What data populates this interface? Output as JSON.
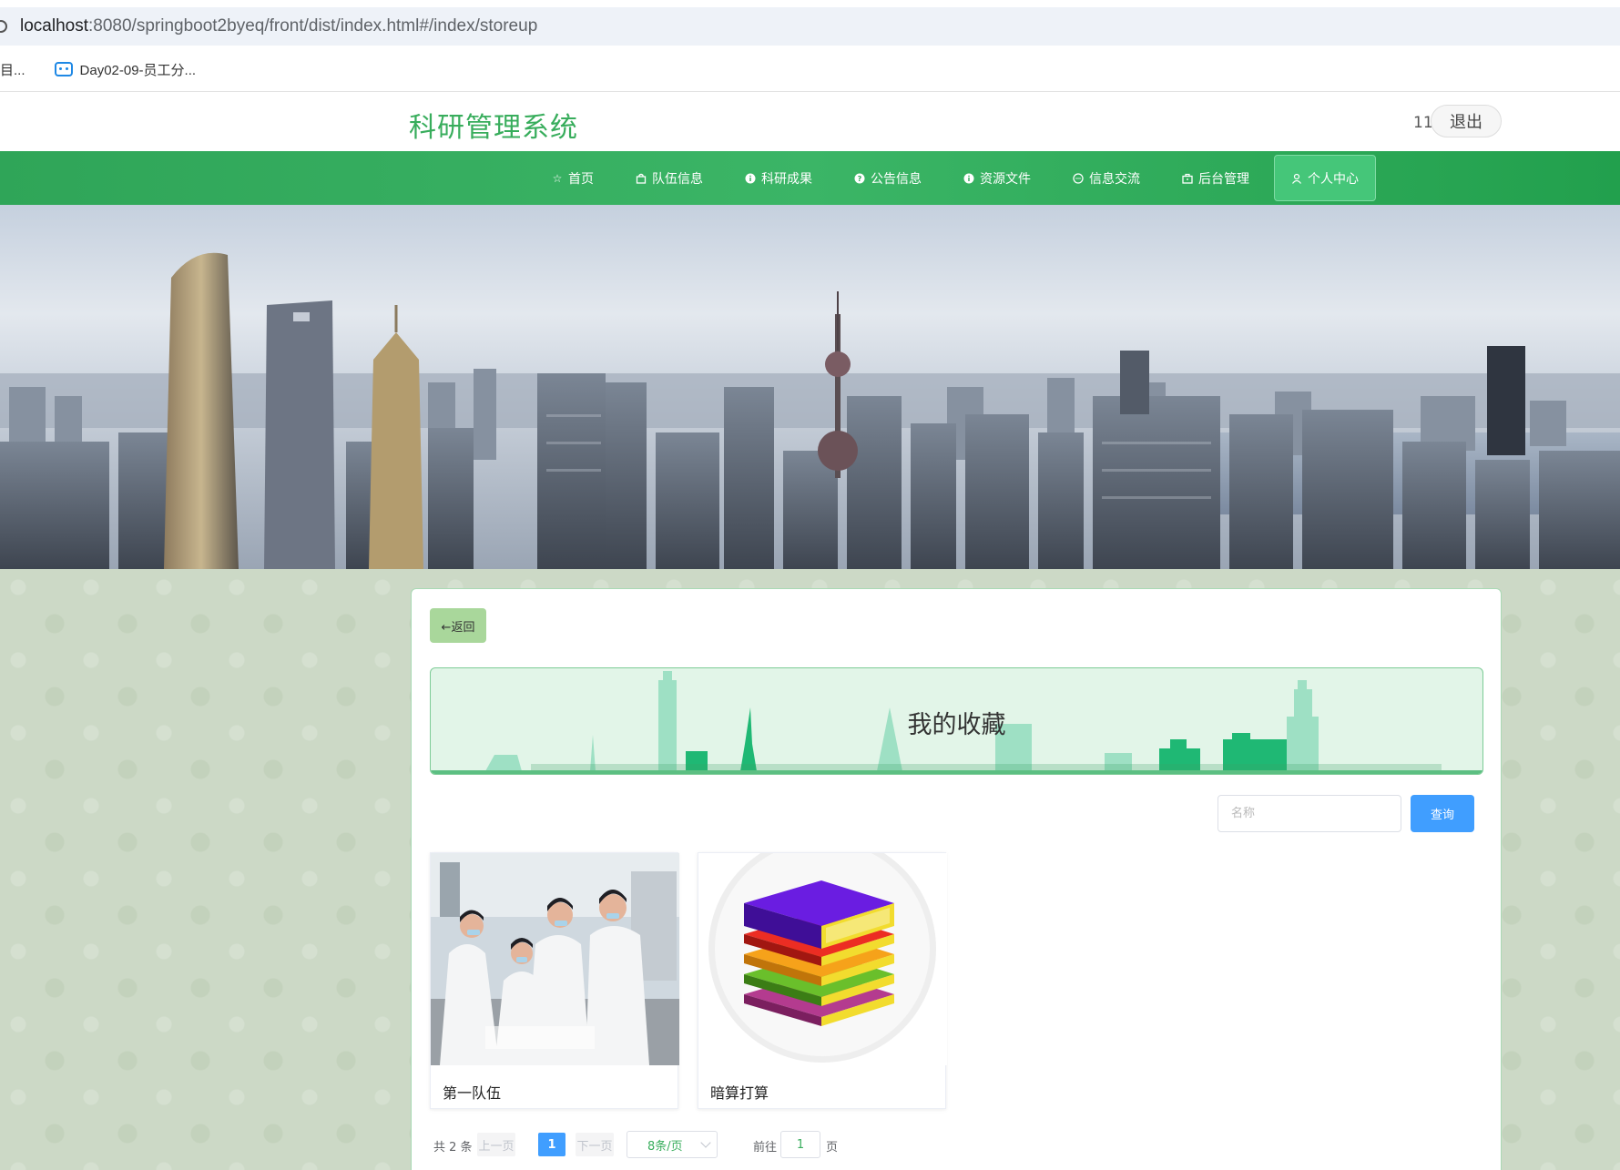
{
  "browser": {
    "url_host": "localhost",
    "url_path": ":8080/springboot2byeq/front/dist/index.html#/index/storeup",
    "bookmarks": [
      {
        "label": "目..."
      },
      {
        "label": "Day02-09-员工分..."
      }
    ]
  },
  "header": {
    "title": "科研管理系统",
    "user_number": "11",
    "logout_label": "退出"
  },
  "nav": {
    "items": [
      {
        "label": "首页",
        "icon": "star-icon"
      },
      {
        "label": "队伍信息",
        "icon": "bag-icon"
      },
      {
        "label": "科研成果",
        "icon": "info-icon"
      },
      {
        "label": "公告信息",
        "icon": "question-icon"
      },
      {
        "label": "资源文件",
        "icon": "info-icon"
      },
      {
        "label": "信息交流",
        "icon": "chat-icon"
      },
      {
        "label": "后台管理",
        "icon": "briefcase-icon"
      },
      {
        "label": "个人中心",
        "icon": "user-icon",
        "active": true
      }
    ]
  },
  "main": {
    "back_label": "←返回",
    "page_title": "我的收藏",
    "search": {
      "placeholder": "名称",
      "value": "",
      "button_label": "查询"
    },
    "items": [
      {
        "name": "第一队伍",
        "image": "lab-team-photo"
      },
      {
        "name": "暗算打算",
        "image": "books-stack-icon"
      }
    ],
    "pagination": {
      "total_label": "共 2 条",
      "prev_label": "上一页",
      "current_page": "1",
      "next_label": "下一页",
      "page_size_label": "8条/页",
      "goto_label": "前往",
      "goto_value": "1",
      "page_suffix": "页"
    }
  },
  "colors": {
    "brand_green": "#38ad5c",
    "nav_green": "#2fa558",
    "primary_blue": "#409eff",
    "back_button": "#a9d79b"
  }
}
